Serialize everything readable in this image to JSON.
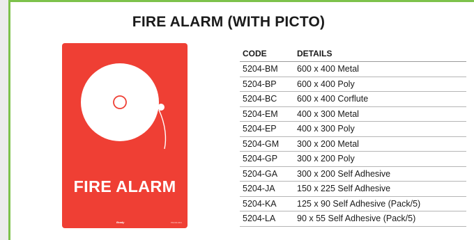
{
  "title": "FIRE ALARM (WITH PICTO)",
  "sign": {
    "label": "FIRE ALARM",
    "brand_logo_text": "Brady",
    "product_code": "PD204-M01",
    "icon": "fire-alarm-bell-icon",
    "background_color": "#ef3f34"
  },
  "accent_color": "#7dc24b",
  "table": {
    "headers": [
      "CODE",
      "DETAILS"
    ],
    "rows": [
      {
        "code": "5204-BM",
        "details": "600 x 400 Metal"
      },
      {
        "code": "5204-BP",
        "details": "600 x 400 Poly"
      },
      {
        "code": "5204-BC",
        "details": "600 x 400 Corflute"
      },
      {
        "code": "5204-EM",
        "details": "400 x 300 Metal"
      },
      {
        "code": "5204-EP",
        "details": "400 x 300 Poly"
      },
      {
        "code": "5204-GM",
        "details": "300 x 200 Metal"
      },
      {
        "code": "5204-GP",
        "details": "300 x 200 Poly"
      },
      {
        "code": "5204-GA",
        "details": "300 x 200 Self Adhesive"
      },
      {
        "code": "5204-JA",
        "details": "150 x 225 Self Adhesive"
      },
      {
        "code": "5204-KA",
        "details": "125 x 90 Self Adhesive (Pack/5)"
      },
      {
        "code": "5204-LA",
        "details": "90 x 55 Self Adhesive (Pack/5)"
      }
    ]
  }
}
